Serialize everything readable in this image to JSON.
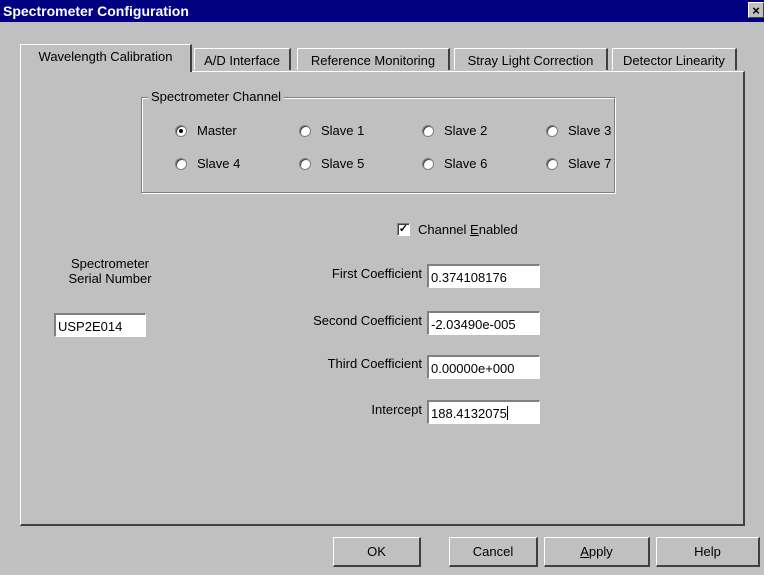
{
  "window": {
    "title": "Spectrometer Configuration",
    "close_glyph": "×"
  },
  "tabs": [
    {
      "label": "Wavelength Calibration",
      "active": true
    },
    {
      "label": "A/D Interface",
      "active": false
    },
    {
      "label": "Reference Monitoring",
      "active": false
    },
    {
      "label": "Stray Light Correction",
      "active": false
    },
    {
      "label": "Detector Linearity",
      "active": false
    }
  ],
  "channel_group": {
    "title": "Spectrometer Channel",
    "options": [
      "Master",
      "Slave 1",
      "Slave 2",
      "Slave 3",
      "Slave 4",
      "Slave 5",
      "Slave 6",
      "Slave 7"
    ],
    "selected": "Master"
  },
  "channel_enabled": {
    "label_pre": "Channel ",
    "label_mnemonic": "E",
    "label_post": "nabled",
    "checked": true,
    "check_glyph": "✓"
  },
  "serial": {
    "label_line1": "Spectrometer",
    "label_line2": "Serial Number",
    "value": "USP2E014"
  },
  "coefficients": {
    "first": {
      "label": "First Coefficient",
      "value": "0.374108176"
    },
    "second": {
      "label": "Second Coefficient",
      "value": "-2.03490e-005"
    },
    "third": {
      "label": "Third Coefficient",
      "value": "0.00000e+000"
    },
    "intercept": {
      "label": "Intercept",
      "value": "188.4132075"
    }
  },
  "buttons": {
    "ok": "OK",
    "cancel": "Cancel",
    "apply_mnemonic": "A",
    "apply_rest": "pply",
    "help": "Help"
  }
}
